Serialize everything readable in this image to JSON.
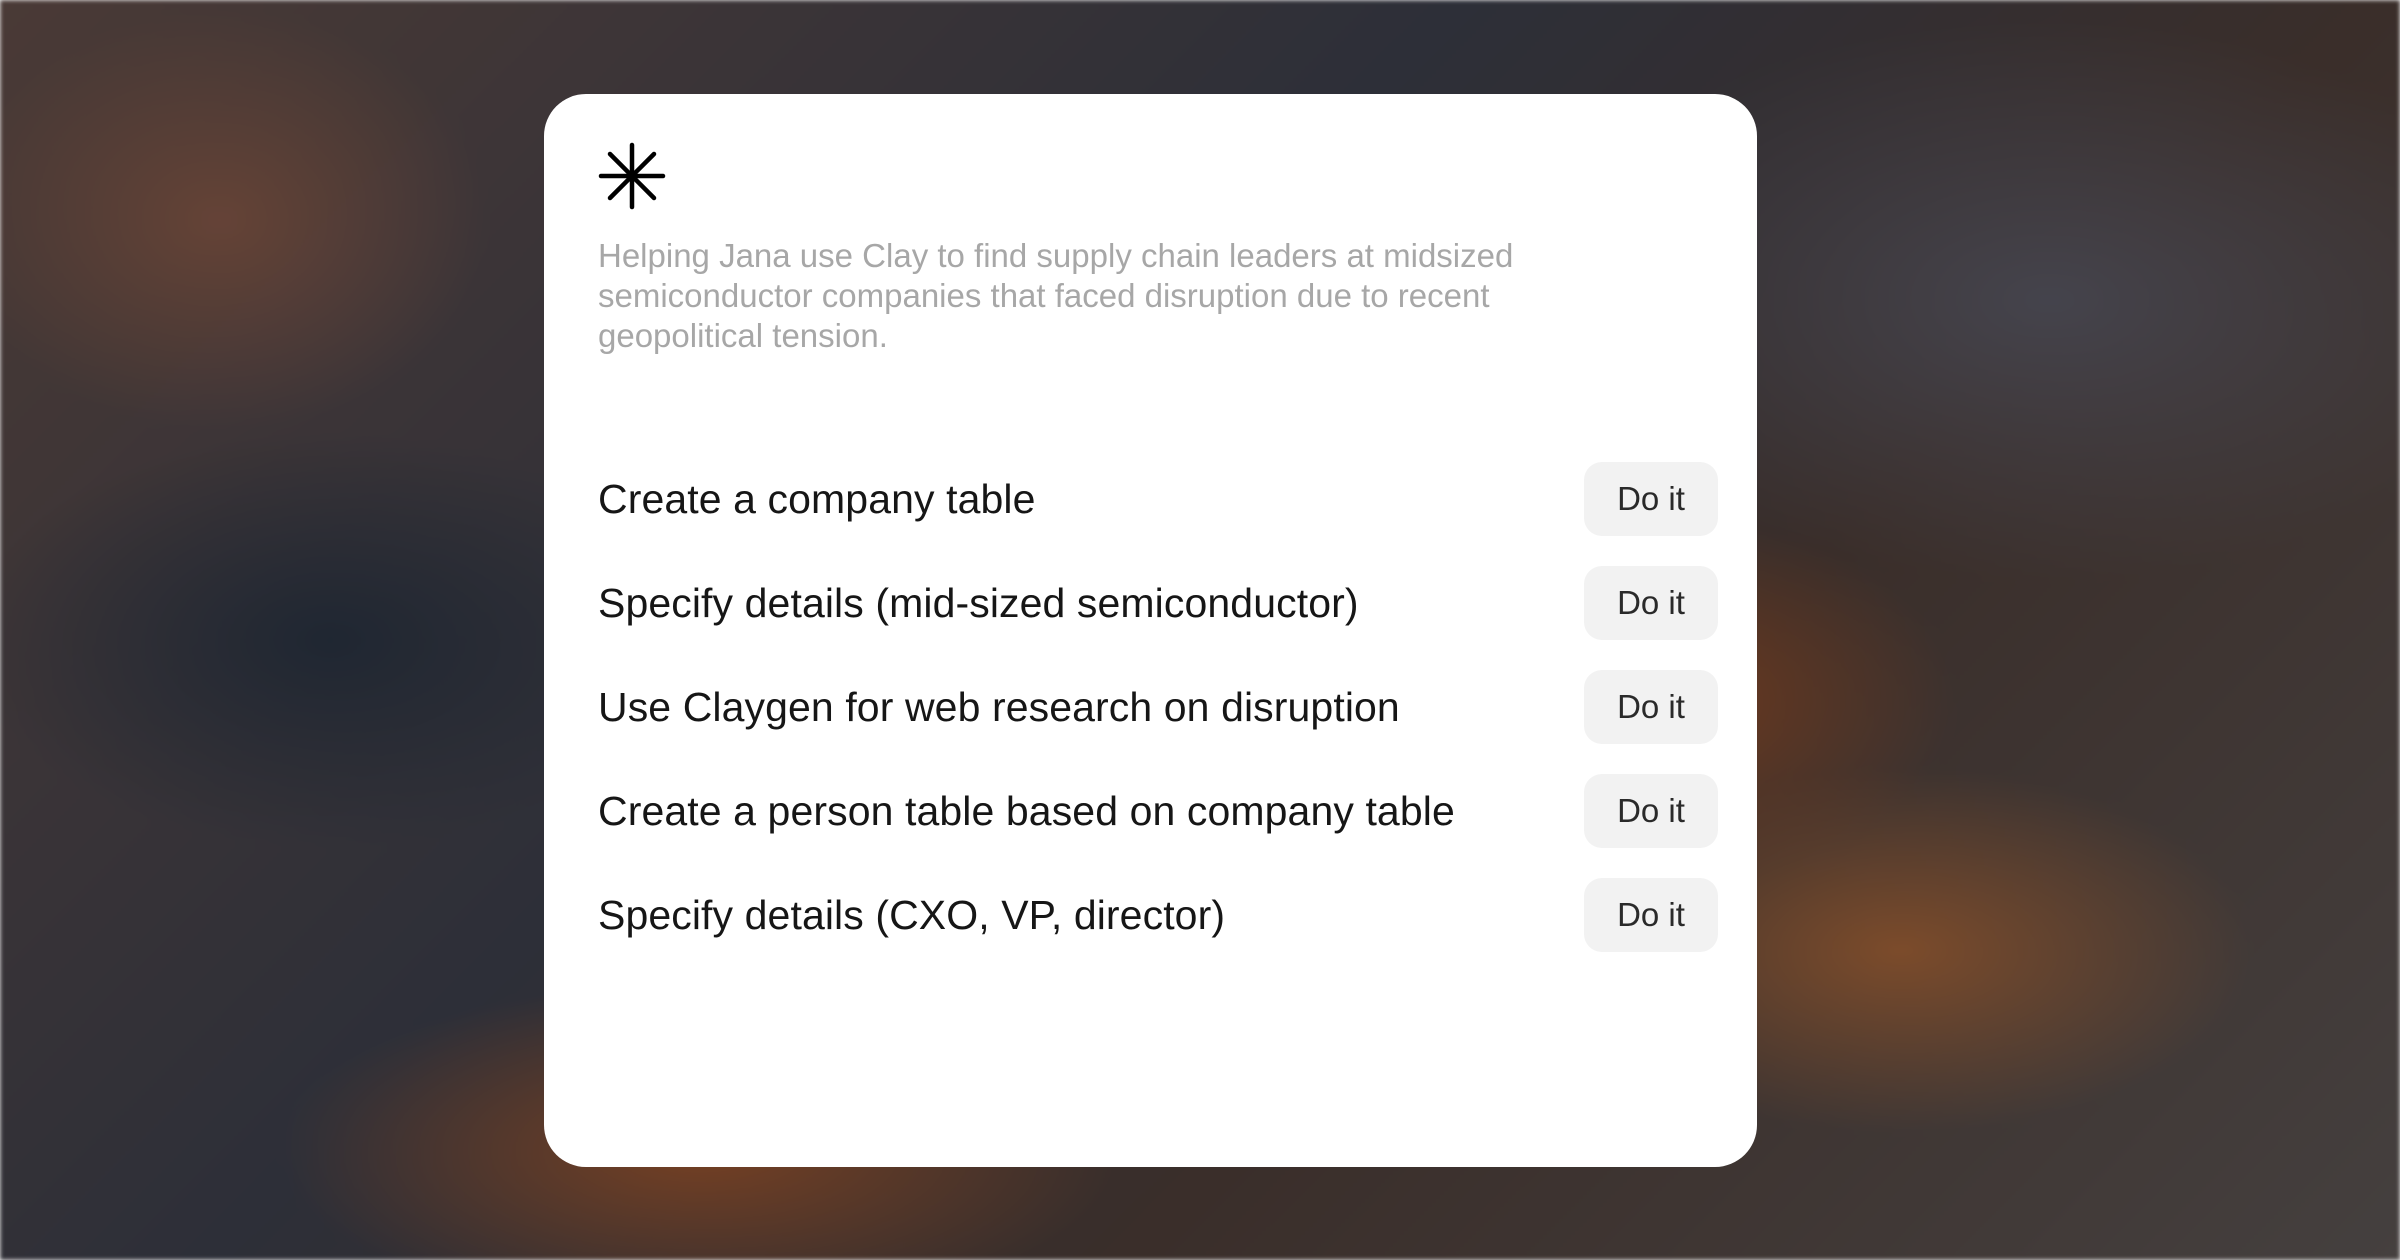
{
  "assistant": {
    "logo_icon": "asterisk-sparkle-icon",
    "intro_text": "Helping Jana use Clay to find supply chain leaders at midsized semiconductor companies that faced disruption due to recent geopolitical tension."
  },
  "steps": [
    {
      "label": "Create a company table",
      "action_label": "Do it"
    },
    {
      "label": "Specify details (mid-sized semiconductor)",
      "action_label": "Do it"
    },
    {
      "label": "Use Claygen for web research on disruption",
      "action_label": "Do it"
    },
    {
      "label": "Create a person table based on company table",
      "action_label": "Do it"
    },
    {
      "label": "Specify details (CXO, VP, director)",
      "action_label": "Do it"
    }
  ],
  "colors": {
    "card_background": "#ffffff",
    "intro_text": "#a7a7a7",
    "step_text": "#161616",
    "button_background": "#f2f2f2"
  }
}
